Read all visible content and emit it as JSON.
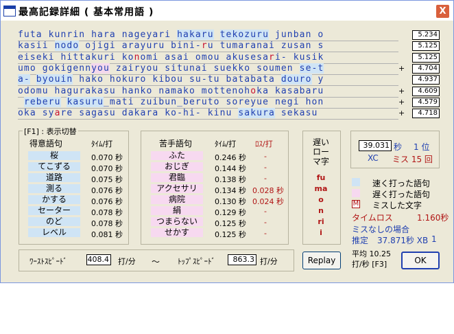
{
  "window": {
    "title": "最高記録詳細 ( 基本常用語 )",
    "close_label": "X"
  },
  "roman_lines": [
    [
      [
        "t",
        "futa kunrin hara nageyari "
      ],
      [
        "hl",
        "hakaru"
      ],
      [
        "t",
        " "
      ],
      [
        "hl",
        "tekozuru"
      ],
      [
        "t",
        " junban o"
      ]
    ],
    [
      [
        "t",
        "kasii "
      ],
      [
        "hl",
        "nodo"
      ],
      [
        "t",
        " ojigi arayuru bini-"
      ],
      [
        "m",
        "r"
      ],
      [
        "t",
        "u tumaranai zusan s"
      ]
    ],
    [
      [
        "t",
        "eiseki hittakuri ko"
      ],
      [
        "m",
        "n"
      ],
      [
        "t",
        "omi asai omou akusesa"
      ],
      [
        "m",
        "r"
      ],
      [
        "t",
        "i- kusik"
      ]
    ],
    [
      [
        "t",
        "umo gokigenn"
      ],
      [
        "hp",
        "you"
      ],
      [
        "t",
        " zairyou situnai suekko soumen "
      ],
      [
        "hl",
        "se-t"
      ]
    ],
    [
      [
        "hl",
        "a-"
      ],
      [
        "t",
        " "
      ],
      [
        "hl",
        "byouin"
      ],
      [
        "t",
        " hako hokuro kibou su-tu batabata "
      ],
      [
        "hl",
        "douro"
      ],
      [
        "t",
        " y"
      ]
    ],
    [
      [
        "t",
        "odomu hagurakasu hanko namako mottenoh"
      ],
      [
        "m",
        "o"
      ],
      [
        "t",
        "ka kasabaru"
      ]
    ],
    [
      [
        "t",
        " "
      ],
      [
        "hl",
        "reberu"
      ],
      [
        "t",
        " "
      ],
      [
        "hl",
        "kasuru"
      ],
      [
        "t",
        "_mati zuibun_beruto soreyue negi hon"
      ]
    ],
    [
      [
        "t",
        "oka sy"
      ],
      [
        "m",
        "a"
      ],
      [
        "t",
        "re sagasu dakara ko-hi- kinu "
      ],
      [
        "hl",
        "sakura"
      ],
      [
        "t",
        " sekasu"
      ]
    ]
  ],
  "line_times": [
    {
      "plus": "",
      "time": "5.234"
    },
    {
      "plus": "",
      "time": "5.125"
    },
    {
      "plus": "",
      "time": "5.125"
    },
    {
      "plus": "+",
      "time": "4.704"
    },
    {
      "plus": "",
      "time": "4.937"
    },
    {
      "plus": "+",
      "time": "4.609"
    },
    {
      "plus": "+",
      "time": "4.579"
    },
    {
      "plus": "+",
      "time": "4.718"
    }
  ],
  "good": {
    "section_label": "[F1] : 表示切替",
    "header_word": "得意語句",
    "header_time": "ﾀｲﾑ/打",
    "rows": [
      {
        "word": "桜",
        "time": "0.070 秒"
      },
      {
        "word": "てこずる",
        "time": "0.070 秒"
      },
      {
        "word": "道路",
        "time": "0.075 秒"
      },
      {
        "word": "測る",
        "time": "0.076 秒"
      },
      {
        "word": "かする",
        "time": "0.076 秒"
      },
      {
        "word": "セーター",
        "time": "0.078 秒"
      },
      {
        "word": "のど",
        "time": "0.078 秒"
      },
      {
        "word": "レベル",
        "time": "0.081 秒"
      }
    ]
  },
  "bad": {
    "header_word": "苦手語句",
    "header_time": "ﾀｲﾑ/打",
    "header_loss": "ﾛｽ/打",
    "rows": [
      {
        "word": "ふた",
        "time": "0.246 秒",
        "loss": "-"
      },
      {
        "word": "おじぎ",
        "time": "0.144 秒",
        "loss": "-"
      },
      {
        "word": "君臨",
        "time": "0.138 秒",
        "loss": "-"
      },
      {
        "word": "アクセサリ",
        "time": "0.134 秒",
        "loss": "0.028 秒"
      },
      {
        "word": "病院",
        "time": "0.130 秒",
        "loss": "0.024 秒"
      },
      {
        "word": "絹",
        "time": "0.129 秒",
        "loss": "-"
      },
      {
        "word": "つまらない",
        "time": "0.125 秒",
        "loss": "-"
      },
      {
        "word": "せかす",
        "time": "0.125 秒",
        "loss": "-"
      }
    ]
  },
  "slow": {
    "title_lines": [
      "遅い",
      "ロー",
      "マ字"
    ],
    "chars": [
      "fu",
      "ma",
      "o",
      "n",
      "ri",
      "i"
    ]
  },
  "result": {
    "time": "39.031",
    "time_unit": "秒",
    "rank": "1 位",
    "level": "XC",
    "miss": "ミス 15 回"
  },
  "legend": {
    "fast_label": "速く打った語句",
    "slow_label": "遅く打った語句",
    "miss_mark": "M",
    "miss_label": "ミスした文字"
  },
  "stats": {
    "timeloss_label": "タイムロス",
    "timeloss_value": "1.160秒",
    "nomiss_label": "ミスなしの場合",
    "estimate_label": "推定",
    "estimate_value": "37.871秒 XB",
    "estimate_rank": "1",
    "avg_label": "平均 10.25",
    "avg_unit": "打/秒 [F3]"
  },
  "speed": {
    "worst_label": "ﾜｰｽﾄｽﾋﾟｰﾄﾞ",
    "worst_value": "408.4",
    "unit1": "打/分",
    "tilde": "〜",
    "top_label": "ﾄｯﾌﾟｽﾋﾟｰﾄﾞ",
    "top_value": "863.3",
    "unit2": "打/分"
  },
  "buttons": {
    "replay": "Replay",
    "ok": "OK"
  },
  "colors": {
    "fast": "#cfe4f5",
    "slow": "#f7d9f0",
    "miss": "#c8102e",
    "roman": "#1f3fb0"
  }
}
